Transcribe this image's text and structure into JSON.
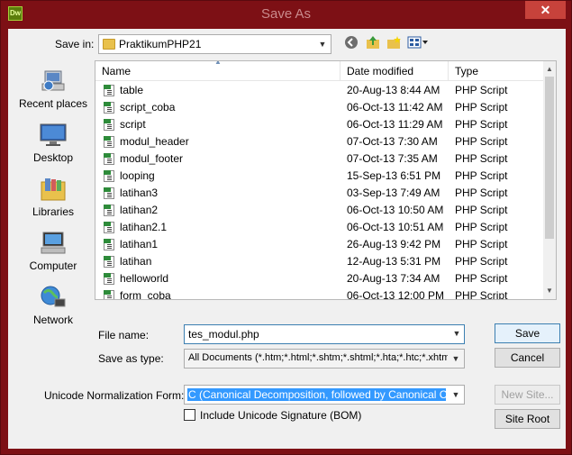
{
  "window": {
    "title": "Save As",
    "app_icon": "Dw",
    "close_glyph": "✕"
  },
  "save_in": {
    "label": "Save in:",
    "value": "PraktikumPHP21"
  },
  "toolbar": {
    "icons": [
      "back-icon",
      "up-folder-icon",
      "new-folder-icon",
      "view-menu-icon"
    ]
  },
  "places": [
    {
      "label": "Recent places",
      "icon": "recent-places-icon"
    },
    {
      "label": "Desktop",
      "icon": "desktop-icon"
    },
    {
      "label": "Libraries",
      "icon": "libraries-icon"
    },
    {
      "label": "Computer",
      "icon": "computer-icon"
    },
    {
      "label": "Network",
      "icon": "network-icon"
    }
  ],
  "file_list": {
    "columns": [
      "Name",
      "Date modified",
      "Type"
    ],
    "rows": [
      {
        "name": "table",
        "date": "20-Aug-13 8:44 AM",
        "type": "PHP Script"
      },
      {
        "name": "script_coba",
        "date": "06-Oct-13 11:42 AM",
        "type": "PHP Script"
      },
      {
        "name": "script",
        "date": "06-Oct-13 11:29 AM",
        "type": "PHP Script"
      },
      {
        "name": "modul_header",
        "date": "07-Oct-13 7:30 AM",
        "type": "PHP Script"
      },
      {
        "name": "modul_footer",
        "date": "07-Oct-13 7:35 AM",
        "type": "PHP Script"
      },
      {
        "name": "looping",
        "date": "15-Sep-13 6:51 PM",
        "type": "PHP Script"
      },
      {
        "name": "latihan3",
        "date": "03-Sep-13 7:49 AM",
        "type": "PHP Script"
      },
      {
        "name": "latihan2",
        "date": "06-Oct-13 10:50 AM",
        "type": "PHP Script"
      },
      {
        "name": "latihan2.1",
        "date": "06-Oct-13 10:51 AM",
        "type": "PHP Script"
      },
      {
        "name": "latihan1",
        "date": "26-Aug-13 9:42 PM",
        "type": "PHP Script"
      },
      {
        "name": "latihan",
        "date": "12-Aug-13 5:31 PM",
        "type": "PHP Script"
      },
      {
        "name": "helloworld",
        "date": "20-Aug-13 7:34 AM",
        "type": "PHP Script"
      },
      {
        "name": "form_coba",
        "date": "06-Oct-13 12:00 PM",
        "type": "PHP Script"
      }
    ]
  },
  "file_name": {
    "label": "File name:",
    "value": "tes_modul.php"
  },
  "save_as_type": {
    "label": "Save as type:",
    "value": "All Documents (*.htm;*.html;*.shtm;*.shtml;*.hta;*.htc;*.xhtml;*.s"
  },
  "unicode_form": {
    "label": "Unicode Normalization Form:",
    "value": "C (Canonical Decomposition, followed by Canonical Composi"
  },
  "bom": {
    "label": "Include Unicode Signature (BOM)",
    "checked": false
  },
  "buttons": {
    "save": "Save",
    "cancel": "Cancel",
    "new_site": "New Site...",
    "site_root": "Site Root"
  },
  "colors": {
    "titlebar": "#7d1015",
    "selection": "#3399ff",
    "close": "#c7423b"
  }
}
